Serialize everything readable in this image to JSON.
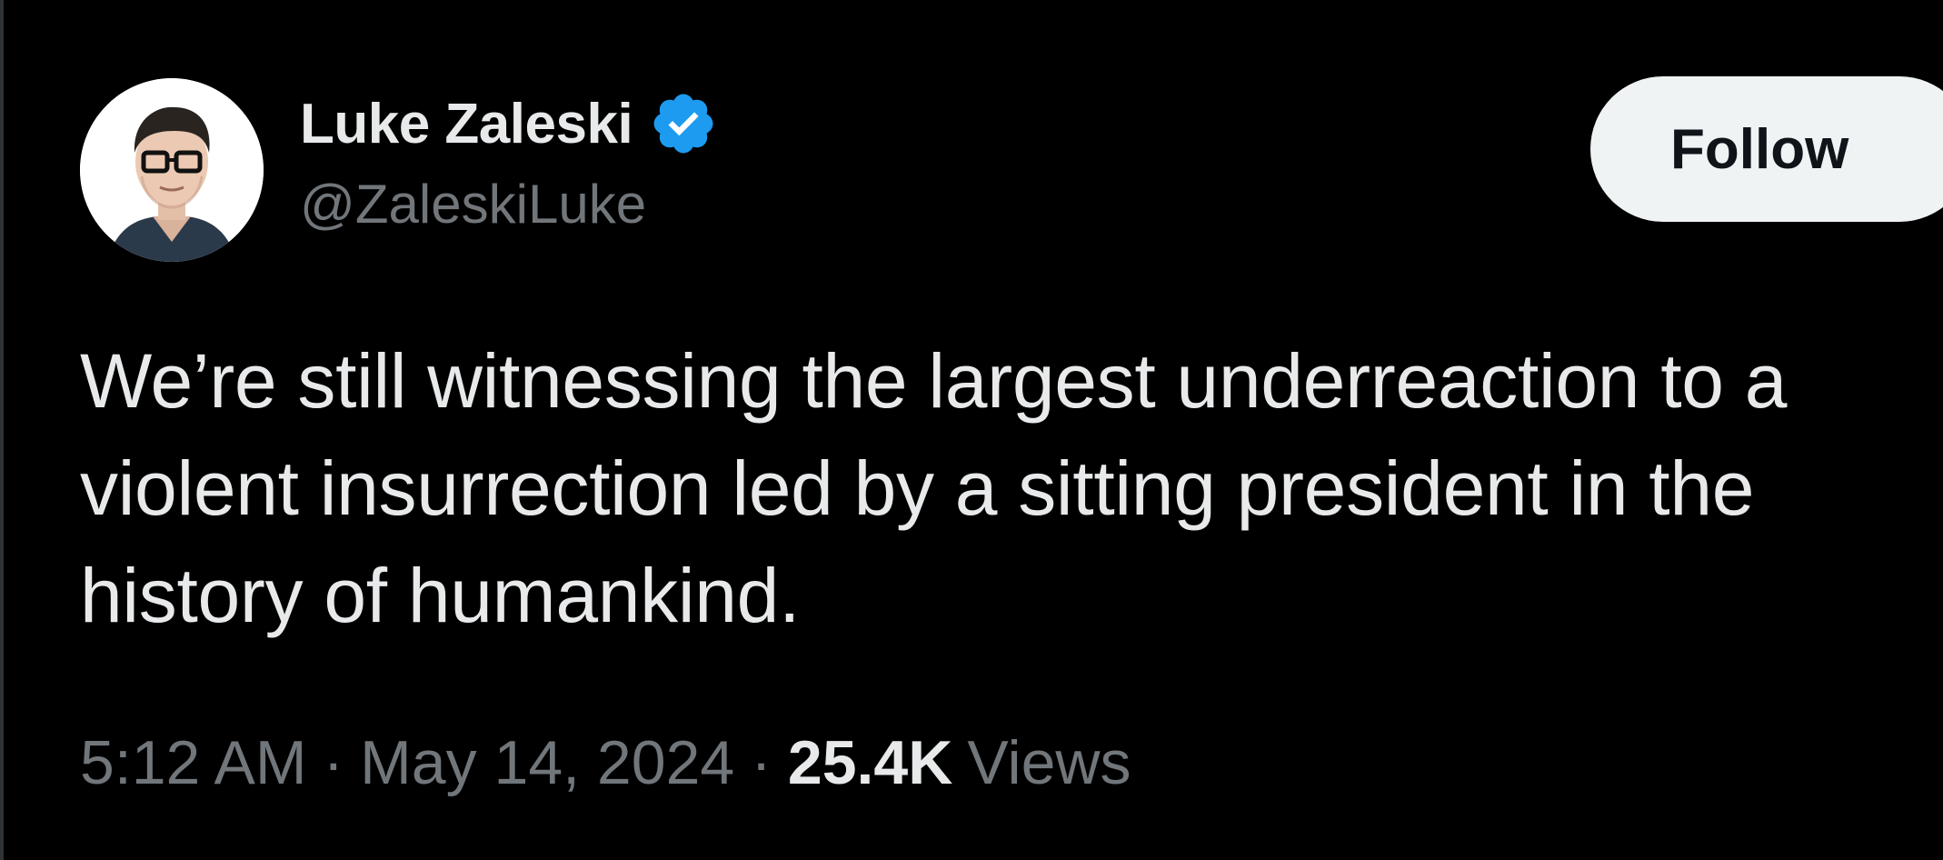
{
  "author": {
    "display_name": "Luke Zaleski",
    "handle": "@ZaleskiLuke",
    "verified": true,
    "verified_icon": "verified-badge-icon",
    "avatar": "profile-avatar"
  },
  "actions": {
    "follow_label": "Follow"
  },
  "tweet": {
    "text": "We’re still witnessing the largest underreaction to a violent insurrection led by a sitting president in the history of humankind."
  },
  "meta": {
    "time": "5:12 AM",
    "separator": "·",
    "date": "May 14, 2024",
    "views_count": "25.4K",
    "views_label": "Views"
  },
  "colors": {
    "background": "#000000",
    "primary_text": "#e7e9ea",
    "secondary_text": "#71767b",
    "verified_blue": "#1d9bf0",
    "follow_button_bg": "#eff3f4",
    "follow_button_text": "#0f1419"
  }
}
